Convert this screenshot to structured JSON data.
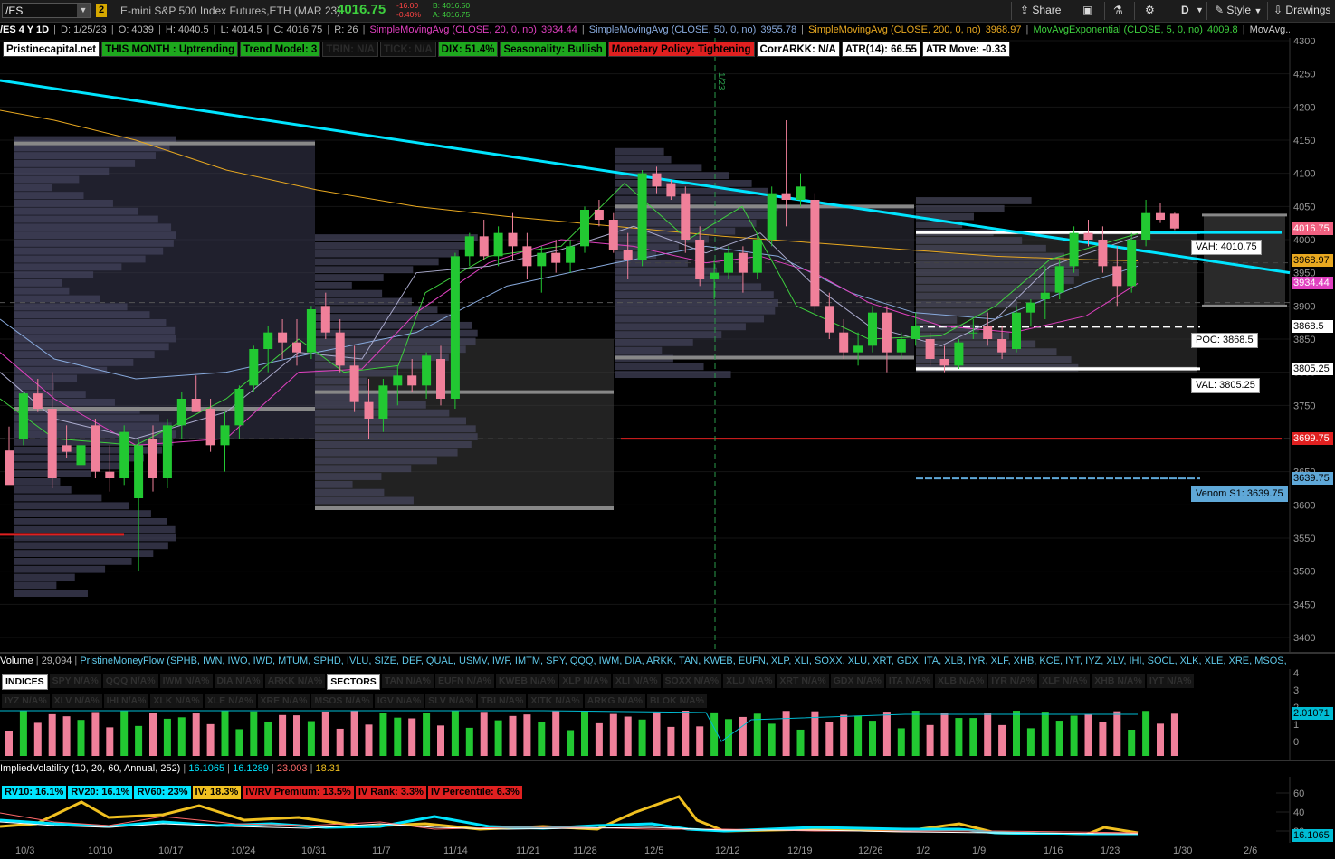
{
  "toolbar": {
    "symbol": "/ES",
    "link_badge": "2",
    "description": "E-mini S&P 500 Index Futures,ETH (MAR 23)",
    "last": "4016.75",
    "change": "-16.00",
    "change_pct": "-0.40%",
    "bid": "B: 4016.50",
    "ask": "A: 4016.75",
    "share": "Share",
    "timeframe": "D",
    "style": "Style",
    "drawings": "Drawings"
  },
  "studybar": {
    "chart_id": "/ES 4 Y 1D",
    "date": "D: 1/25/23",
    "open": "O: 4039",
    "high": "H: 4040.5",
    "low": "L: 4014.5",
    "close": "C: 4016.75",
    "range": "R: 26",
    "sma20": "SimpleMovingAvg (CLOSE, 20, 0, no)",
    "sma20_val": "3934.44",
    "sma50": "SimpleMovingAvg (CLOSE, 50, 0, no)",
    "sma50_val": "3955.78",
    "sma200": "SimpleMovingAvg (CLOSE, 200, 0, no)",
    "sma200_val": "3968.97",
    "ema5": "MovAvgExponential (CLOSE, 5, 0, no)",
    "ema5_val": "4009.8",
    "more": "MovAvg..."
  },
  "labels": [
    {
      "text": "Pristinecapital.net",
      "bg": "#ffffff",
      "fg": "#000000"
    },
    {
      "text": "THIS MONTH : Uptrending",
      "bg": "#1ea81e",
      "fg": "#000000"
    },
    {
      "text": "Trend Model: 3",
      "bg": "#1ea81e",
      "fg": "#000000"
    },
    {
      "text": "TRIN: N/A",
      "bg": "#111111",
      "fg": "#2a2a2a"
    },
    {
      "text": "TICK: N/A",
      "bg": "#111111",
      "fg": "#2a2a2a"
    },
    {
      "text": "DIX: 51.4%",
      "bg": "#1ea81e",
      "fg": "#000000"
    },
    {
      "text": "Seasonality: Bullish",
      "bg": "#1ea81e",
      "fg": "#000000"
    },
    {
      "text": "Monetary Policy: Tightening",
      "bg": "#e02020",
      "fg": "#000000"
    },
    {
      "text": "CorrARKK: N/A",
      "bg": "#ffffff",
      "fg": "#000000"
    },
    {
      "text": "ATR(14): 66.55",
      "bg": "#ffffff",
      "fg": "#000000"
    },
    {
      "text": "ATR Move: -0.33",
      "bg": "#ffffff",
      "fg": "#000000"
    }
  ],
  "price_tags": [
    {
      "text": "4016.75",
      "bg": "#f06080",
      "fg": "#ffffff"
    },
    {
      "text": "3968.97",
      "bg": "#e8a820",
      "fg": "#000000"
    },
    {
      "text": "3934.44",
      "bg": "#e040c0",
      "fg": "#ffffff"
    },
    {
      "text": "3868.5",
      "bg": "#ffffff",
      "fg": "#000000"
    },
    {
      "text": "3805.25",
      "bg": "#ffffff",
      "fg": "#000000"
    },
    {
      "text": "3699.75",
      "bg": "#e02020",
      "fg": "#ffffff"
    },
    {
      "text": "3639.75",
      "bg": "#5fa8d8",
      "fg": "#000000"
    }
  ],
  "volume_profile_labels": {
    "vah": "VAH: 4010.75",
    "poc": "POC: 3868.5",
    "val": "VAL: 3805.25",
    "venom": "Venom S1: 3639.75"
  },
  "vertical_marker": "1/23",
  "volume_pane": {
    "title": "Volume",
    "value": "29,094",
    "flow": "PristineMoneyFlow (SPHB, IWN, IWO, IWD, MTUM, SPHD, IVLU, SIZE, DEF, QUAL, USMV, IWF, IMTM, SPY, QQQ, IWM, DIA, ARKK, TAN, KWEB, EUFN, XLP, XLI, SOXX, XLU, XRT, GDX, ITA, XLB, IYR, XLF, XHB, KCE, IYT, IYZ, XLV, IHI, SOCL, XLK, XLE, XRE, MSOS, IGV,...",
    "indices_hdr": "INDICES",
    "indices": [
      "SPY N/A%",
      "QQQ N/A%",
      "IWM N/A%",
      "DIA N/A%",
      "ARKK N/A%"
    ],
    "sectors_hdr": "SECTORS",
    "sectors": [
      "TAN N/A%",
      "EUFN N/A%",
      "KWEB N/A%",
      "XLP N/A%",
      "XLI N/A%",
      "SOXX N/A%",
      "XLU N/A%",
      "XRT N/A%",
      "GDX N/A%",
      "ITA N/A%",
      "XLB N/A%",
      "IYR N/A%",
      "XLF N/A%",
      "XHB N/A%",
      "IYT N/A%"
    ],
    "row3": [
      "IYZ N/A%",
      "XLV N/A%",
      "IHI N/A%",
      "XLK N/A%",
      "XLE N/A%",
      "XRE N/A%",
      "MSOS N/A%",
      "IGV N/A%",
      "SLV N/A%",
      "TBI N/A%",
      "XITK N/A%",
      "ARKG N/A%",
      "BLOK N/A%"
    ],
    "tag_value": "2.01071",
    "axis": [
      "4",
      "3",
      "2",
      "1",
      "0"
    ]
  },
  "iv_pane": {
    "title": "ImpliedVolatility (10, 20, 60, Annual, 252)",
    "values": [
      "16.1065",
      "16.1289",
      "23.003",
      "18.31"
    ],
    "chips": [
      {
        "text": "RV10: 16.1%",
        "bg": "#00e5ff",
        "fg": "#000000"
      },
      {
        "text": "RV20: 16.1%",
        "bg": "#00e5ff",
        "fg": "#000000"
      },
      {
        "text": "RV60: 23%",
        "bg": "#00e5ff",
        "fg": "#000000"
      },
      {
        "text": "IV: 18.3%",
        "bg": "#f0c020",
        "fg": "#000000"
      },
      {
        "text": "IV/RV Premium: 13.5%",
        "bg": "#e02020",
        "fg": "#000000"
      },
      {
        "text": "IV Rank: 3.3%",
        "bg": "#e02020",
        "fg": "#000000"
      },
      {
        "text": "IV Percentile: 6.3%",
        "bg": "#e02020",
        "fg": "#000000"
      }
    ],
    "tag_value": "16.1065",
    "axis": [
      "60",
      "40",
      "20"
    ]
  },
  "chart_data": {
    "type": "candlestick",
    "y_ticks": [
      4300,
      4250,
      4200,
      4150,
      4100,
      4050,
      4000,
      3950,
      3900,
      3850,
      3800,
      3750,
      3700,
      3650,
      3600,
      3550,
      3500,
      3450,
      3400
    ],
    "ylim": [
      3380,
      4310
    ],
    "x_labels": [
      "10/3",
      "10/10",
      "10/17",
      "10/24",
      "10/31",
      "11/7",
      "11/14",
      "11/21",
      "11/28",
      "12/5",
      "12/12",
      "12/19",
      "12/26",
      "1/2",
      "1/9",
      "1/16",
      "1/23",
      "1/30",
      "2/6"
    ],
    "candles": [
      [
        3682,
        3718,
        3640,
        3630
      ],
      [
        3700,
        3770,
        3690,
        3768
      ],
      [
        3768,
        3790,
        3740,
        3745
      ],
      [
        3745,
        3800,
        3625,
        3640
      ],
      [
        3690,
        3720,
        3670,
        3680
      ],
      [
        3660,
        3700,
        3640,
        3690
      ],
      [
        3720,
        3730,
        3640,
        3650
      ],
      [
        3650,
        3690,
        3620,
        3640
      ],
      [
        3640,
        3720,
        3630,
        3710
      ],
      [
        3610,
        3700,
        3500,
        3690
      ],
      [
        3700,
        3720,
        3620,
        3640
      ],
      [
        3640,
        3730,
        3625,
        3720
      ],
      [
        3720,
        3770,
        3700,
        3760
      ],
      [
        3760,
        3795,
        3740,
        3740
      ],
      [
        3745,
        3760,
        3680,
        3690
      ],
      [
        3690,
        3740,
        3650,
        3720
      ],
      [
        3720,
        3780,
        3700,
        3775
      ],
      [
        3780,
        3840,
        3770,
        3835
      ],
      [
        3835,
        3870,
        3800,
        3860
      ],
      [
        3860,
        3880,
        3820,
        3845
      ],
      [
        3845,
        3880,
        3810,
        3830
      ],
      [
        3830,
        3900,
        3820,
        3895
      ],
      [
        3900,
        3920,
        3850,
        3860
      ],
      [
        3860,
        3880,
        3800,
        3810
      ],
      [
        3810,
        3840,
        3740,
        3755
      ],
      [
        3755,
        3790,
        3700,
        3730
      ],
      [
        3730,
        3790,
        3710,
        3780
      ],
      [
        3780,
        3810,
        3750,
        3795
      ],
      [
        3795,
        3820,
        3770,
        3780
      ],
      [
        3780,
        3830,
        3760,
        3825
      ],
      [
        3820,
        3840,
        3750,
        3760
      ],
      [
        3760,
        3980,
        3745,
        3975
      ],
      [
        3975,
        4010,
        3960,
        4005
      ],
      [
        4005,
        4030,
        3970,
        3975
      ],
      [
        3975,
        4020,
        3960,
        4010
      ],
      [
        4010,
        4040,
        3970,
        3990
      ],
      [
        3990,
        4010,
        3940,
        3960
      ],
      [
        3960,
        3990,
        3920,
        3980
      ],
      [
        3980,
        4000,
        3950,
        3965
      ],
      [
        3965,
        4000,
        3950,
        3990
      ],
      [
        3990,
        4050,
        3980,
        4045
      ],
      [
        4045,
        4060,
        4020,
        4030
      ],
      [
        4030,
        4040,
        3980,
        3985
      ],
      [
        3985,
        4010,
        3940,
        3970
      ],
      [
        3970,
        4105,
        3960,
        4100
      ],
      [
        4100,
        4110,
        4070,
        4080
      ],
      [
        4085,
        4090,
        4060,
        4065
      ],
      [
        4070,
        4080,
        3980,
        4000
      ],
      [
        4000,
        4020,
        3930,
        3940
      ],
      [
        3940,
        3970,
        3910,
        3950
      ],
      [
        3950,
        3990,
        3940,
        3980
      ],
      [
        3980,
        3990,
        3920,
        3950
      ],
      [
        3950,
        4010,
        3940,
        4000
      ],
      [
        4000,
        4080,
        3990,
        4070
      ],
      [
        4070,
        4180,
        4020,
        4060
      ],
      [
        4060,
        4100,
        4050,
        4080
      ],
      [
        4060,
        4070,
        3890,
        3900
      ],
      [
        3900,
        3920,
        3850,
        3860
      ],
      [
        3860,
        3880,
        3820,
        3830
      ],
      [
        3830,
        3860,
        3810,
        3840
      ],
      [
        3840,
        3900,
        3830,
        3890
      ],
      [
        3890,
        3900,
        3800,
        3830
      ],
      [
        3830,
        3860,
        3820,
        3850
      ],
      [
        3850,
        3890,
        3840,
        3870
      ],
      [
        3850,
        3860,
        3810,
        3820
      ],
      [
        3820,
        3840,
        3800,
        3810
      ],
      [
        3810,
        3850,
        3805,
        3845
      ],
      [
        3860,
        3880,
        3850,
        3860
      ],
      [
        3870,
        3890,
        3840,
        3850
      ],
      [
        3850,
        3870,
        3820,
        3830
      ],
      [
        3835,
        3900,
        3830,
        3890
      ],
      [
        3890,
        3910,
        3870,
        3905
      ],
      [
        3910,
        3960,
        3880,
        3920
      ],
      [
        3920,
        3970,
        3910,
        3960
      ],
      [
        3960,
        4020,
        3950,
        4010
      ],
      [
        4010,
        4030,
        3990,
        4000
      ],
      [
        4000,
        4020,
        3950,
        3960
      ],
      [
        3960,
        3990,
        3900,
        3930
      ],
      [
        3930,
        4010,
        3920,
        4000
      ],
      [
        4000,
        4060,
        3990,
        4040
      ],
      [
        4040,
        4055,
        4025,
        4030
      ],
      [
        4039,
        4040.5,
        4014.5,
        4016.75
      ]
    ],
    "vah": 4010.75,
    "poc": 3868.5,
    "val": 3805.25,
    "venom": 3639.75,
    "red_level": 3699.75,
    "sma200": 3968.97,
    "sma20": 3934.44
  }
}
